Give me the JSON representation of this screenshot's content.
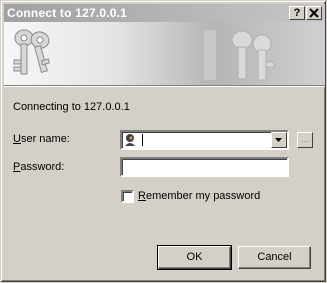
{
  "window": {
    "title": "Connect to 127.0.0.1"
  },
  "titlebar": {
    "help_label": "?",
    "close_label": "✕"
  },
  "banner": {
    "icon": "keys-icon"
  },
  "connecting_text": "Connecting to 127.0.0.1",
  "form": {
    "username_label_u": "U",
    "username_label_rest": "ser name:",
    "username_value": "",
    "password_label_u": "P",
    "password_label_rest": "assword:",
    "password_value": "",
    "remember_label_u": "R",
    "remember_label_rest": "emember my password",
    "remember_checked": false,
    "browse_label": "..."
  },
  "buttons": {
    "ok": "OK",
    "cancel": "Cancel"
  },
  "colors": {
    "title_start": "#a1a1a1",
    "title_end": "#c6c6c6",
    "face": "#d4d0c8"
  }
}
